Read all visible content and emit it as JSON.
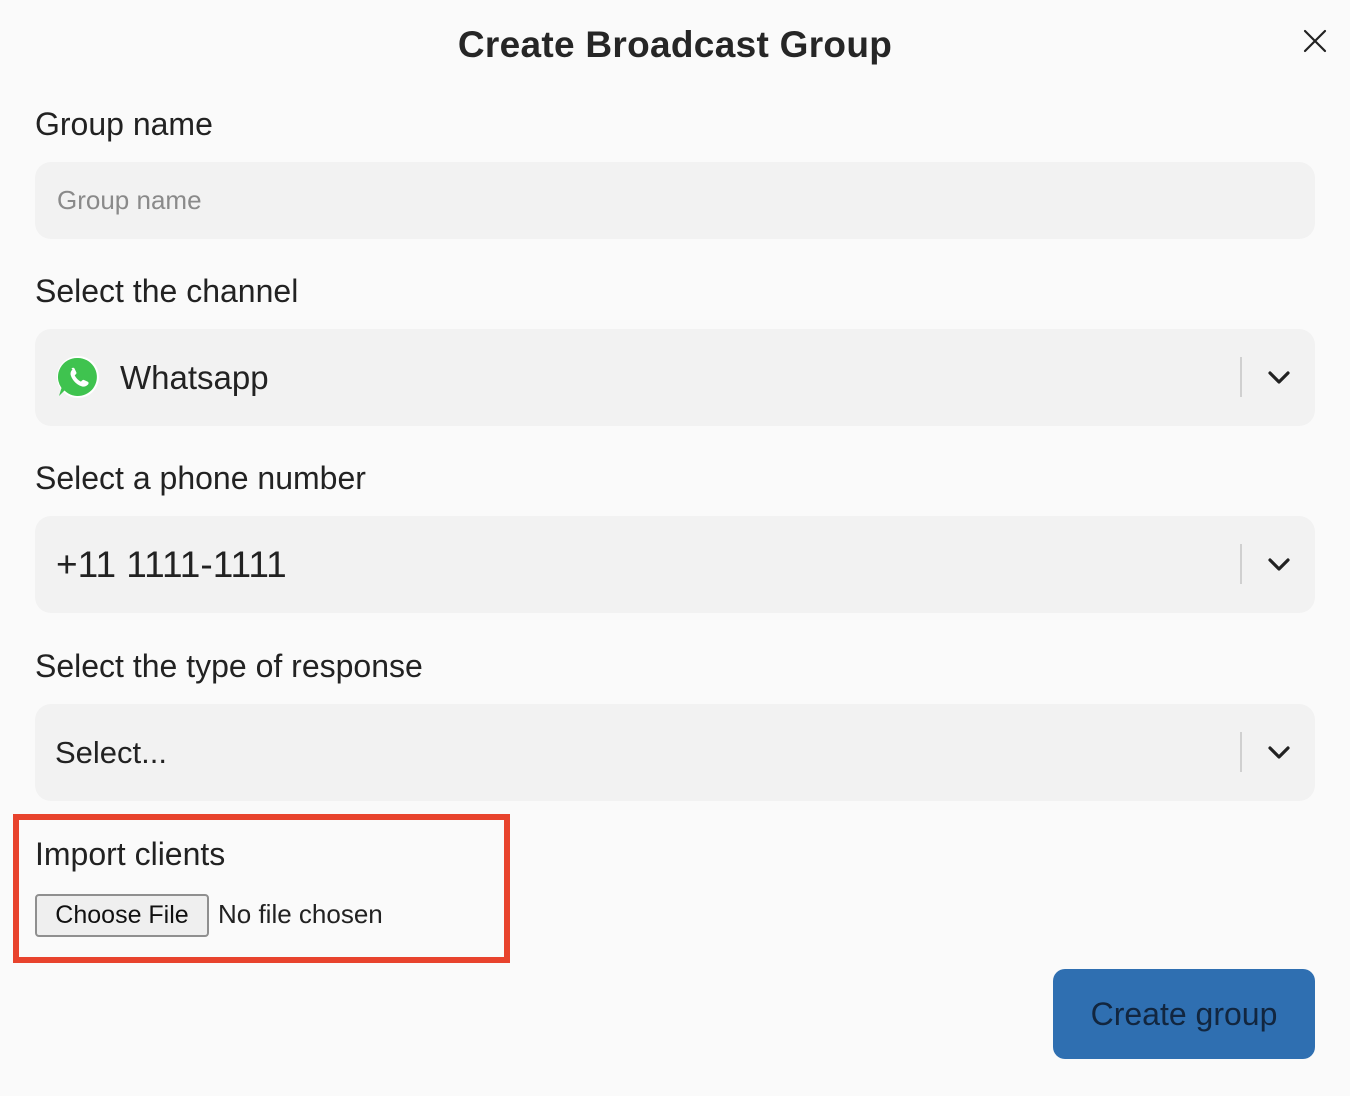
{
  "dialog": {
    "title": "Create Broadcast Group",
    "close_icon": "close-icon"
  },
  "group_name": {
    "label": "Group name",
    "placeholder": "Group name",
    "value": ""
  },
  "channel": {
    "label": "Select the channel",
    "selected": "Whatsapp",
    "icon": "whatsapp-icon",
    "icon_color": "#3fc34f"
  },
  "phone": {
    "label": "Select a phone number",
    "selected": "+11 1111-1111"
  },
  "response_type": {
    "label": "Select the type of response",
    "placeholder": "Select..."
  },
  "import": {
    "label": "Import clients",
    "button_label": "Choose File",
    "status": "No file chosen",
    "highlight_color": "#e8432d"
  },
  "actions": {
    "create_label": "Create group",
    "create_color": "#2f6fb1"
  }
}
